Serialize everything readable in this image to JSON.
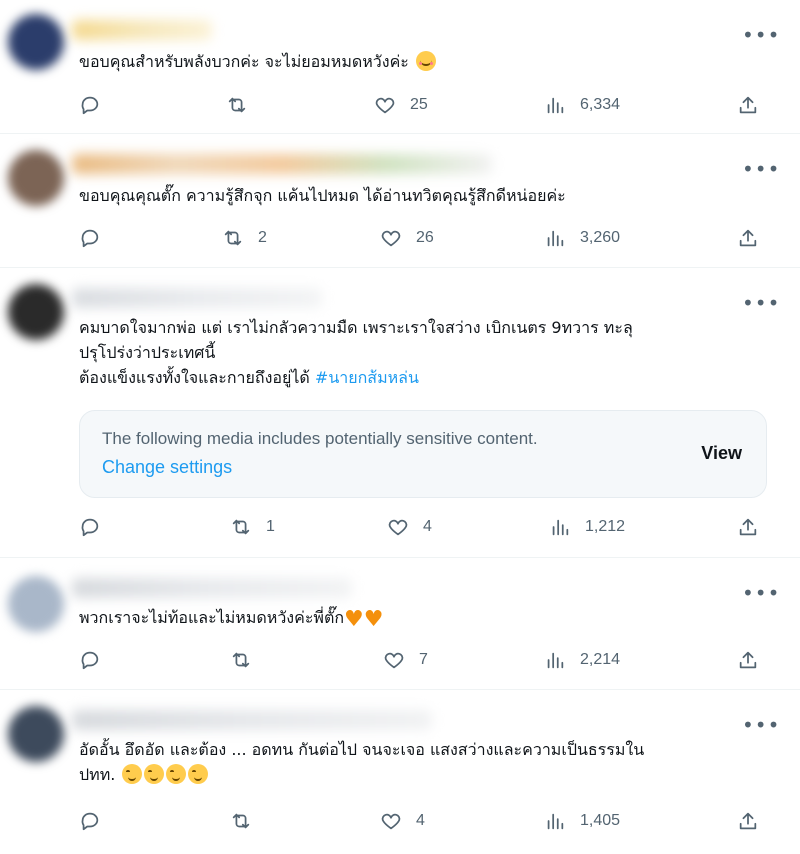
{
  "tweets": [
    {
      "text": "ขอบคุณสำหรับพลังบวกค่ะ จะไม่ยอมหมดหวังค่ะ",
      "emoji_icon": "smiling-face-icon",
      "replies": "",
      "retweets": "",
      "likes": "25",
      "views": "6,334"
    },
    {
      "text": "ขอบคุณคุณตั๊ก  ความรู้สึกจุก แค้นไปหมด ได้อ่านทวิตคุณรู้สึกดีหน่อยค่ะ",
      "replies": "",
      "retweets": "2",
      "likes": "26",
      "views": "3,260"
    },
    {
      "text_line1": "คมบาดใจมากพ่อ  แต่ เราไม่กลัวความมืด เพราะเราใจสว่าง เบิกเนตร 9ทวาร ทะลุ",
      "text_line2": "ปรุโปร่งว่าประเทศนี้",
      "text_line3": "ต้องแข็งแรงทั้งใจและกายถึงอยู่ได้ ",
      "hashtag": "#นายกส้มหล่น",
      "sensitive_message": "The following media includes potentially sensitive content.",
      "change_settings": "Change settings",
      "view_label": "View",
      "replies": "",
      "retweets": "1",
      "likes": "4",
      "views": "1,212"
    },
    {
      "text": "พวกเราจะไม่ท้อและไม่หมดหวังค่ะพี่ตั๊ก",
      "emoji_icon": "orange-heart-icon",
      "replies": "",
      "retweets": "",
      "likes": "7",
      "views": "2,214"
    },
    {
      "text_line1": "อัดอั้น อึดอัด และต้อง ... อดทน กันต่อไป จนจะเจอ แสงสว่างและความเป็นธรรมใน",
      "text_line2": "ปทท. ",
      "emoji_icon": "relieved-face-icon",
      "replies": "",
      "retweets": "",
      "likes": "4",
      "views": "1,405"
    }
  ],
  "colors": {
    "text": "#0f1419",
    "muted": "#536471",
    "link": "#1d9bf0",
    "divider": "#eff3f4"
  }
}
